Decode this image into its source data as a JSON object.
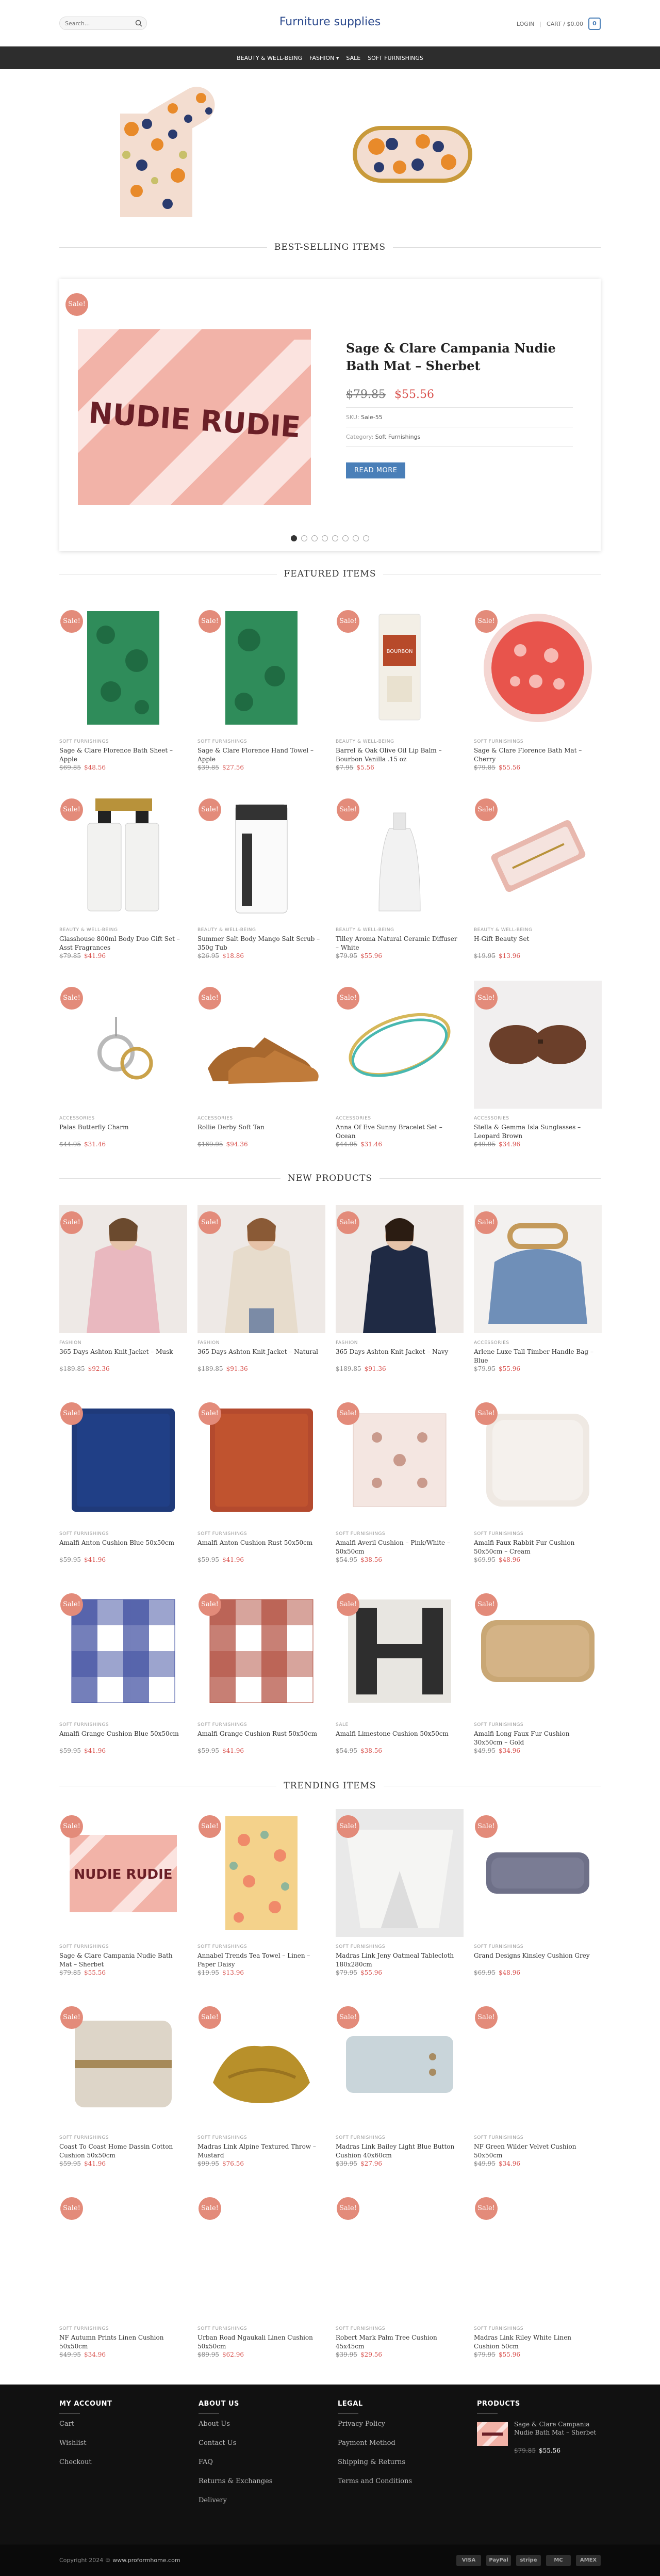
{
  "header": {
    "search_placeholder": "Search...",
    "logo": "Furniture supplies",
    "login": "LOGIN",
    "cart": "CART / $0.00",
    "cart_count": "0"
  },
  "nav": [
    "BEAUTY & WELL-BEING",
    "FASHION",
    "SALE",
    "SOFT FURNISHINGS"
  ],
  "sections": {
    "best_selling": "BEST-SELLING ITEMS",
    "featured": "FEATURED ITEMS",
    "new": "NEW PRODUCTS",
    "trending": "TRENDING ITEMS"
  },
  "sale_label": "Sale!",
  "slider": {
    "title": "Sage & Clare Campania Nudie Bath Mat – Sherbet",
    "price_old": "$79.85",
    "price_new": "$55.56",
    "sku_label": "SKU:",
    "sku": "Sale-55",
    "category_label": "Category:",
    "category": "Soft Furnishings",
    "read_more": "READ MORE",
    "mat_text": "NUDIE RUDIE"
  },
  "featured": [
    {
      "cat": "SOFT FURNISHINGS",
      "name": "Sage & Clare Florence Bath Sheet – Apple",
      "old": "$69.85",
      "new": "$48.56"
    },
    {
      "cat": "SOFT FURNISHINGS",
      "name": "Sage & Clare Florence Hand Towel – Apple",
      "old": "$39.85",
      "new": "$27.56"
    },
    {
      "cat": "BEAUTY & WELL-BEING",
      "name": "Barrel & Oak Olive Oil Lip Balm – Bourbon Vanilla .15 oz",
      "old": "$7.95",
      "new": "$5.56"
    },
    {
      "cat": "SOFT FURNISHINGS",
      "name": "Sage & Clare Florence Bath Mat – Cherry",
      "old": "$79.85",
      "new": "$55.56"
    },
    {
      "cat": "BEAUTY & WELL-BEING",
      "name": "Glasshouse 800ml Body Duo Gift Set – Asst Fragrances",
      "old": "$79.85",
      "new": "$41.96"
    },
    {
      "cat": "BEAUTY & WELL-BEING",
      "name": "Summer Salt Body Mango Salt Scrub – 350g Tub",
      "old": "$26.95",
      "new": "$18.86"
    },
    {
      "cat": "BEAUTY & WELL-BEING",
      "name": "Tilley Aroma Natural Ceramic Diffuser – White",
      "old": "$79.95",
      "new": "$55.96"
    },
    {
      "cat": "BEAUTY & WELL-BEING",
      "name": "H-Gift Beauty Set",
      "old": "$19.95",
      "new": "$13.96"
    },
    {
      "cat": "ACCESSORIES",
      "name": "Palas Butterfly Charm",
      "old": "$44.95",
      "new": "$31.46"
    },
    {
      "cat": "ACCESSORIES",
      "name": "Rollie Derby Soft Tan",
      "old": "$169.95",
      "new": "$94.36"
    },
    {
      "cat": "ACCESSORIES",
      "name": "Anna Of Eve Sunny Bracelet Set – Ocean",
      "old": "$44.95",
      "new": "$31.46"
    },
    {
      "cat": "ACCESSORIES",
      "name": "Stella & Gemma Isla Sunglasses – Leopard Brown",
      "old": "$49.95",
      "new": "$34.96"
    }
  ],
  "new_products": [
    {
      "cat": "FASHION",
      "name": "365 Days Ashton Knit Jacket – Musk",
      "old": "$189.85",
      "new": "$92.36"
    },
    {
      "cat": "FASHION",
      "name": "365 Days Ashton Knit Jacket – Natural",
      "old": "$189.85",
      "new": "$91.36"
    },
    {
      "cat": "FASHION",
      "name": "365 Days Ashton Knit Jacket – Navy",
      "old": "$189.85",
      "new": "$91.36"
    },
    {
      "cat": "ACCESSORIES",
      "name": "Arlene Luxe Tall Timber Handle Bag – Blue",
      "old": "$79.95",
      "new": "$55.96"
    },
    {
      "cat": "SOFT FURNISHINGS",
      "name": "Amalfi Anton Cushion Blue 50x50cm",
      "old": "$59.95",
      "new": "$41.96"
    },
    {
      "cat": "SOFT FURNISHINGS",
      "name": "Amalfi Anton Cushion Rust 50x50cm",
      "old": "$59.95",
      "new": "$41.96"
    },
    {
      "cat": "SOFT FURNISHINGS",
      "name": "Amalfi Averil Cushion – Pink/White – 50x50cm",
      "old": "$54.95",
      "new": "$38.56"
    },
    {
      "cat": "SOFT FURNISHINGS",
      "name": "Amalfi Faux Rabbit Fur Cushion 50x50cm – Cream",
      "old": "$69.95",
      "new": "$48.96"
    },
    {
      "cat": "SOFT FURNISHINGS",
      "name": "Amalfi Grange Cushion Blue 50x50cm",
      "old": "$59.95",
      "new": "$41.96"
    },
    {
      "cat": "SOFT FURNISHINGS",
      "name": "Amalfi Grange Cushion Rust 50x50cm",
      "old": "$59.95",
      "new": "$41.96"
    },
    {
      "cat": "SALE",
      "name": "Amalfi Limestone Cushion 50x50cm",
      "old": "$54.95",
      "new": "$38.56"
    },
    {
      "cat": "SOFT FURNISHINGS",
      "name": "Amalfi Long Faux Fur Cushion 30x50cm – Gold",
      "old": "$49.95",
      "new": "$34.96"
    }
  ],
  "trending": [
    {
      "cat": "SOFT FURNISHINGS",
      "name": "Sage & Clare Campania Nudie Bath Mat – Sherbet",
      "old": "$79.85",
      "new": "$55.56"
    },
    {
      "cat": "SOFT FURNISHINGS",
      "name": "Annabel Trends Tea Towel – Linen – Paper Daisy",
      "old": "$19.95",
      "new": "$13.96"
    },
    {
      "cat": "SOFT FURNISHINGS",
      "name": "Madras Link Jeny Oatmeal Tablecloth 180x280cm",
      "old": "$79.95",
      "new": "$55.96"
    },
    {
      "cat": "SOFT FURNISHINGS",
      "name": "Grand Designs Kinsley Cushion Grey",
      "old": "$69.95",
      "new": "$48.96"
    },
    {
      "cat": "SOFT FURNISHINGS",
      "name": "Coast To Coast Home Dassin Cotton Cushion 50x50cm",
      "old": "$59.95",
      "new": "$41.96"
    },
    {
      "cat": "SOFT FURNISHINGS",
      "name": "Madras Link Alpine Textured Throw – Mustard",
      "old": "$99.95",
      "new": "$76.56"
    },
    {
      "cat": "SOFT FURNISHINGS",
      "name": "Madras Link Bailey Light Blue Button Cushion 40x60cm",
      "old": "$39.95",
      "new": "$27.96"
    },
    {
      "cat": "SOFT FURNISHINGS",
      "name": "NF Green Wilder Velvet Cushion 50x50cm",
      "old": "$49.95",
      "new": "$34.96"
    },
    {
      "cat": "SOFT FURNISHINGS",
      "name": "NF Autumn Prints Linen Cushion 50x50cm",
      "old": "$49.95",
      "new": "$34.96"
    },
    {
      "cat": "SOFT FURNISHINGS",
      "name": "Urban Road Ngaukali Linen Cushion 50x50cm",
      "old": "$89.95",
      "new": "$62.96"
    },
    {
      "cat": "SOFT FURNISHINGS",
      "name": "Robert Mark Palm Tree Cushion 45x45cm",
      "old": "$39.95",
      "new": "$29.56"
    },
    {
      "cat": "SOFT FURNISHINGS",
      "name": "Madras Link Riley White Linen Cushion 50cm",
      "old": "$79.95",
      "new": "$55.96"
    }
  ],
  "footer": {
    "my_account": {
      "title": "MY ACCOUNT",
      "links": [
        "Cart",
        "Wishlist",
        "Checkout"
      ]
    },
    "about": {
      "title": "ABOUT US",
      "links": [
        "About Us",
        "Contact Us",
        "FAQ",
        "Returns & Exchanges",
        "Delivery"
      ]
    },
    "legal": {
      "title": "LEGAL",
      "links": [
        "Privacy Policy",
        "Payment Method",
        "Shipping & Returns",
        "Terms and Conditions"
      ]
    },
    "products": {
      "title": "PRODUCTS",
      "item_name": "Sage & Clare Campania Nudie Bath Mat – Sherbet",
      "old": "$79.85",
      "new": "$55.56"
    },
    "copyright_prefix": "Copyright 2024 ©",
    "copyright_site": "www.proformhome.com",
    "payments": [
      "VISA",
      "PayPal",
      "stripe",
      "MC",
      "AMEX"
    ]
  },
  "colors": {
    "accent": "#4a7fb8",
    "sale_badge": "#e38b7a",
    "price_new": "#d9534f",
    "nav_bg": "#2d2d2d",
    "footer_bg": "#111111"
  }
}
